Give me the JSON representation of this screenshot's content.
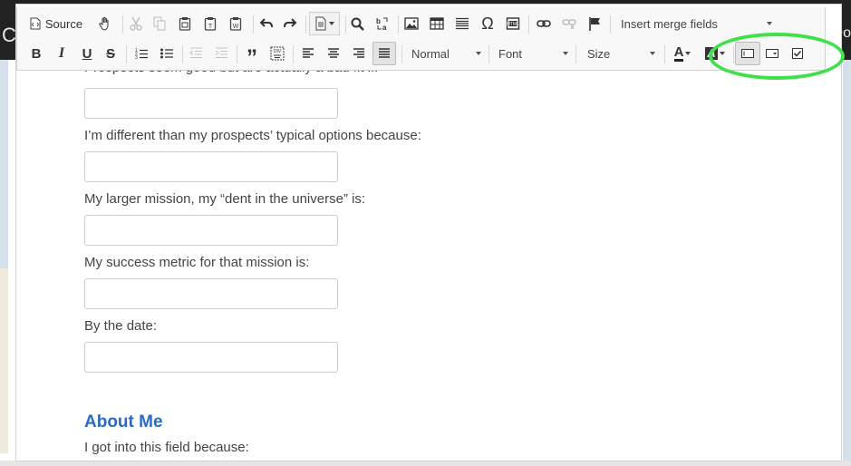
{
  "background": {
    "header_left_text": "C",
    "header_right_text": "↻ Do"
  },
  "toolbar": {
    "row1": {
      "source_label": "Source",
      "merge_fields_placeholder": "Insert merge fields"
    },
    "row2": {
      "bold": "B",
      "italic": "I",
      "underline": "U",
      "strike": "S",
      "blockquote": "”",
      "format_combo": "Normal",
      "font_combo": "Font",
      "size_combo": "Size",
      "text_color_letter": "A",
      "bg_color_letter": "A"
    },
    "highlight_color": "#3fe04a"
  },
  "content": {
    "cut_text": "Prospects seem good but are actually a bad fit if:",
    "fields": [
      {
        "label": "I’m different than my prospects’ typical options because:",
        "value": ""
      },
      {
        "label": "My larger mission, my “dent in the universe” is:",
        "value": ""
      },
      {
        "label": "My success metric for that mission is:",
        "value": ""
      },
      {
        "label": "By the date:",
        "value": ""
      }
    ],
    "section_heading": "About Me",
    "last_label": "I got into this field because:"
  },
  "colors": {
    "heading": "#2a6ac8",
    "text": "#444444",
    "toolbar_bg": "#f8f8f8"
  }
}
